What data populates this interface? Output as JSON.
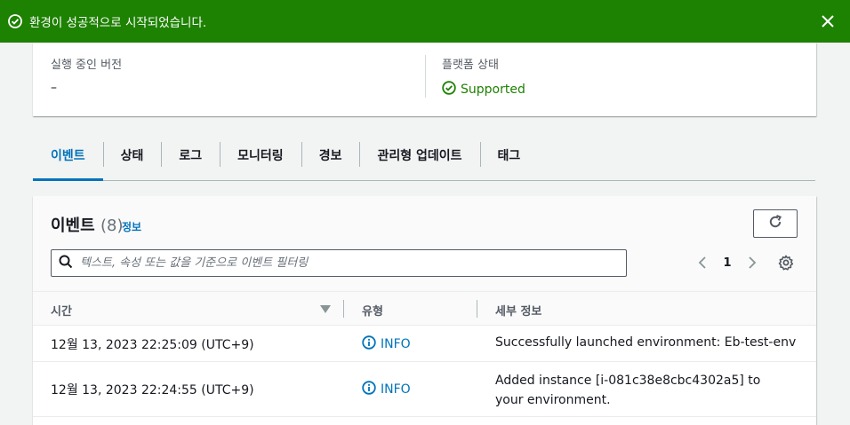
{
  "flash": {
    "message": "환경이 성공적으로 시작되었습니다."
  },
  "summary": {
    "running_version_label": "실행 중인 버전",
    "running_version_value": "–",
    "platform_status_label": "플랫폼 상태",
    "platform_status_value": "Supported"
  },
  "tabs": [
    {
      "label": "이벤트",
      "active": true
    },
    {
      "label": "상태",
      "active": false
    },
    {
      "label": "로그",
      "active": false
    },
    {
      "label": "모니터링",
      "active": false
    },
    {
      "label": "경보",
      "active": false
    },
    {
      "label": "관리형 업데이트",
      "active": false
    },
    {
      "label": "태그",
      "active": false
    }
  ],
  "events_panel": {
    "title": "이벤트",
    "count": "(8)",
    "info_link": "정보",
    "search_placeholder": "텍스트, 속성 또는 값을 기준으로 이벤트 필터링",
    "current_page": "1",
    "columns": [
      "시간",
      "유형",
      "세부 정보"
    ],
    "rows": [
      {
        "time": "12월 13, 2023 22:25:09 (UTC+9)",
        "type": "INFO",
        "details": "Successfully launched environment: Eb-test-env"
      },
      {
        "time": "12월 13, 2023 22:24:55 (UTC+9)",
        "type": "INFO",
        "details": "Added instance [i-081c38e8cbc4302a5] to your environment."
      }
    ]
  },
  "colors": {
    "success_green": "#1d8102",
    "link_blue": "#0073bb"
  }
}
